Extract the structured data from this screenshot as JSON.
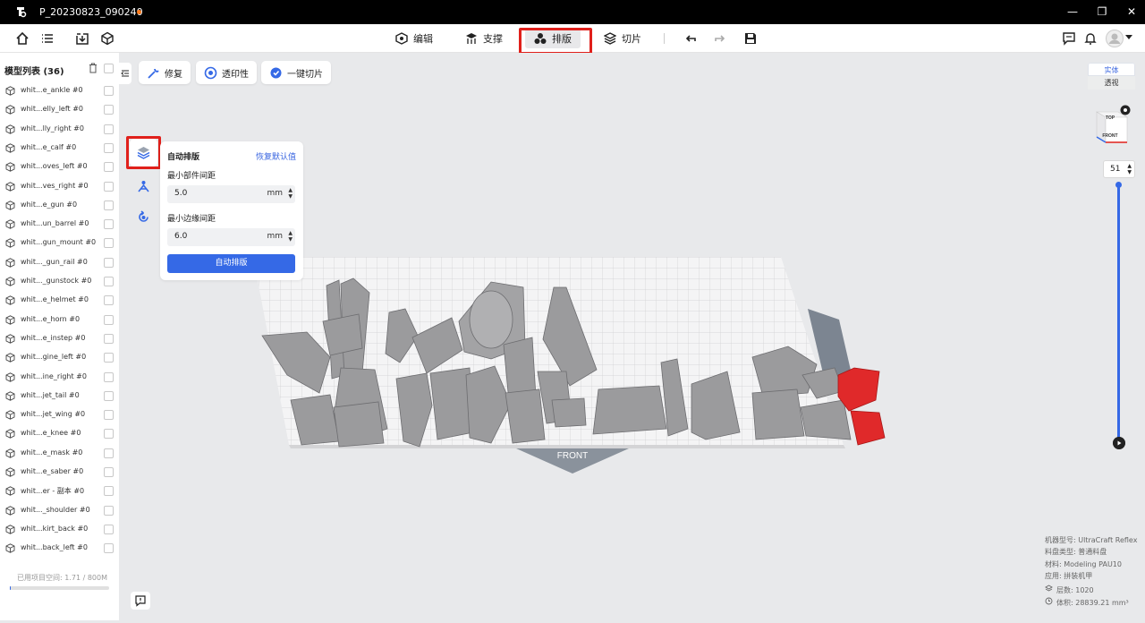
{
  "window": {
    "title": "P_20230823_090240",
    "minimize": "—",
    "maximize": "❐",
    "close": "✕"
  },
  "modes": [
    {
      "label": "编辑",
      "icon": "edit-mode-icon"
    },
    {
      "label": "支撑",
      "icon": "support-mode-icon"
    },
    {
      "label": "排版",
      "icon": "layout-mode-icon",
      "active": true
    },
    {
      "label": "切片",
      "icon": "slice-mode-icon"
    }
  ],
  "sidebar": {
    "header": "模型列表 (36)",
    "items": [
      "whit...e_ankle #0",
      "whit...elly_left #0",
      "whit...lly_right #0",
      "whit...e_calf #0",
      "whit...oves_left #0",
      "whit...ves_right #0",
      "whit...e_gun #0",
      "whit...un_barrel #0",
      "whit...gun_mount #0",
      "whit..._gun_rail #0",
      "whit..._gunstock #0",
      "whit...e_helmet #0",
      "whit...e_horn #0",
      "whit...e_instep #0",
      "whit...gine_left #0",
      "whit...ine_right #0",
      "whit...jet_tail #0",
      "whit...jet_wing #0",
      "whit...e_knee #0",
      "whit...e_mask #0",
      "whit...e_saber #0",
      "whit...er - 副本 #0",
      "whit..._shoulder #0",
      "whit...kirt_back #0",
      "whit...back_left #0"
    ],
    "usage": "已用项目空间: 1.71 / 800M",
    "usage_fraction": 0.002
  },
  "tools": {
    "repair": "修复",
    "transparency": "透印性",
    "one_click_slice": "一键切片"
  },
  "panel": {
    "title": "自动排版",
    "reset": "恢复默认值",
    "min_part_gap_label": "最小部件间距",
    "min_part_gap_value": "5.0",
    "min_edge_gap_label": "最小边缘间距",
    "min_edge_gap_value": "6.0",
    "unit": "mm",
    "button": "自动排版"
  },
  "view": {
    "solid": "实体",
    "perspective": "透视",
    "cube_top": "TOP",
    "cube_front": "FRONT",
    "platform_front": "FRONT"
  },
  "layers": {
    "current": "51"
  },
  "info": {
    "machine": "机器型号:  UltraCraft Reflex",
    "tray": "料盘类型:  普通料盘",
    "material": "材料:  Modeling PAU10",
    "application": "应用:  拼装机甲",
    "layer_count": "层数:  1020",
    "volume": "体积:  28839.21 mm³"
  },
  "colors": {
    "accent": "#3569e6",
    "highlight": "#e0201b",
    "model_gray": "#9a9a9c",
    "model_red": "#e0292a"
  }
}
